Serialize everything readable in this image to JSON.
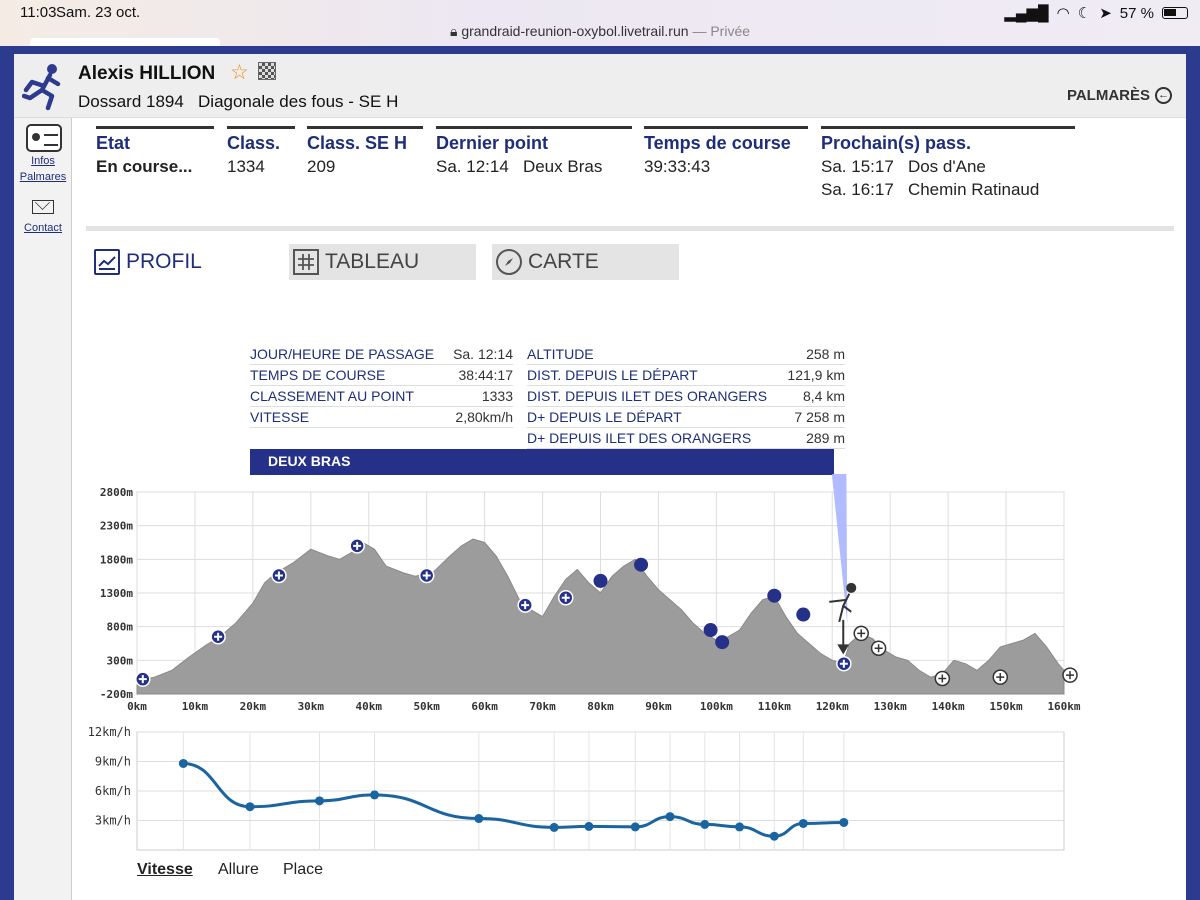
{
  "status_bar": {
    "time": "11:03",
    "date": "Sam. 23 oct.",
    "battery": "57 %",
    "url": "grandraid-reunion-oxybol.livetrail.run",
    "private_label": "— Privée"
  },
  "runner": {
    "name": "Alexis HILLION",
    "bib": "Dossard 1894",
    "race": "Diagonale des fous - SE H"
  },
  "header": {
    "palmares_label": "PALMARÈS"
  },
  "nav": {
    "infos": "Infos",
    "palmares": "Palmares",
    "contact": "Contact"
  },
  "summary": {
    "etat": {
      "label": "Etat",
      "value": "En course..."
    },
    "class": {
      "label": "Class.",
      "value": "1334"
    },
    "class_se": {
      "label": "Class. SE H",
      "value": "209"
    },
    "dernier": {
      "label": "Dernier point",
      "time": "Sa. 12:14",
      "place": "Deux Bras"
    },
    "temps": {
      "label": "Temps de course",
      "value": "39:33:43"
    },
    "prochain": {
      "label": "Prochain(s) pass.",
      "rows": [
        {
          "time": "Sa. 15:17",
          "place": "Dos d'Ane"
        },
        {
          "time": "Sa. 16:17",
          "place": "Chemin Ratinaud"
        }
      ]
    }
  },
  "tabs": {
    "profil": "PROFIL",
    "tableau": "TABLEAU",
    "carte": "CARTE"
  },
  "point_info": {
    "left": [
      {
        "label": "JOUR/HEURE DE PASSAGE",
        "value": "Sa. 12:14"
      },
      {
        "label": "TEMPS DE COURSE",
        "value": "38:44:17"
      },
      {
        "label": "CLASSEMENT AU POINT",
        "value": "1333"
      },
      {
        "label": "VITESSE",
        "value": "2,80km/h"
      }
    ],
    "right": [
      {
        "label": "ALTITUDE",
        "value": "258 m"
      },
      {
        "label": "DIST. DEPUIS LE DÉPART",
        "value": "121,9 km"
      },
      {
        "label": "DIST. DEPUIS ILET DES ORANGERS",
        "value": "8,4 km"
      },
      {
        "label": "D+ DEPUIS LE DÉPART",
        "value": "7 258 m"
      },
      {
        "label": "D+ DEPUIS ILET DES ORANGERS",
        "value": "289 m"
      }
    ],
    "point_name": "DEUX BRAS"
  },
  "chart_data": [
    {
      "type": "area",
      "yticks": [
        "2800m",
        "2300m",
        "1800m",
        "1300m",
        "800m",
        "300m",
        "-200m"
      ],
      "xticks": [
        "0km",
        "10km",
        "20km",
        "30km",
        "40km",
        "50km",
        "60km",
        "70km",
        "80km",
        "90km",
        "100km",
        "110km",
        "120km",
        "130km",
        "140km",
        "150km",
        "160km"
      ],
      "ylim": [
        -200,
        2800
      ],
      "xlim": [
        0,
        160
      ],
      "profile": [
        [
          0,
          0
        ],
        [
          3,
          50
        ],
        [
          6,
          150
        ],
        [
          9,
          350
        ],
        [
          12,
          530
        ],
        [
          14,
          630
        ],
        [
          17,
          850
        ],
        [
          20,
          1150
        ],
        [
          22,
          1450
        ],
        [
          24,
          1600
        ],
        [
          27,
          1750
        ],
        [
          30,
          1950
        ],
        [
          33,
          1850
        ],
        [
          35,
          1800
        ],
        [
          37,
          1900
        ],
        [
          39,
          2050
        ],
        [
          41,
          1950
        ],
        [
          43,
          1700
        ],
        [
          46,
          1600
        ],
        [
          48,
          1550
        ],
        [
          51,
          1600
        ],
        [
          54,
          1850
        ],
        [
          56,
          2000
        ],
        [
          58,
          2100
        ],
        [
          60,
          2050
        ],
        [
          62,
          1850
        ],
        [
          64,
          1550
        ],
        [
          66,
          1200
        ],
        [
          68,
          1050
        ],
        [
          70,
          950
        ],
        [
          72,
          1250
        ],
        [
          74,
          1500
        ],
        [
          76,
          1650
        ],
        [
          78,
          1450
        ],
        [
          80,
          1300
        ],
        [
          82,
          1550
        ],
        [
          84,
          1700
        ],
        [
          86,
          1800
        ],
        [
          88,
          1550
        ],
        [
          90,
          1350
        ],
        [
          92,
          1200
        ],
        [
          94,
          1050
        ],
        [
          96,
          850
        ],
        [
          98,
          700
        ],
        [
          100,
          600
        ],
        [
          102,
          650
        ],
        [
          104,
          750
        ],
        [
          106,
          1000
        ],
        [
          108,
          1200
        ],
        [
          110,
          1250
        ],
        [
          112,
          950
        ],
        [
          114,
          700
        ],
        [
          116,
          550
        ],
        [
          118,
          400
        ],
        [
          120,
          300
        ],
        [
          121.9,
          258
        ],
        [
          123,
          550
        ],
        [
          125,
          700
        ],
        [
          127,
          620
        ],
        [
          129,
          450
        ],
        [
          131,
          350
        ],
        [
          133,
          300
        ],
        [
          135,
          150
        ],
        [
          137,
          50
        ],
        [
          139,
          100
        ],
        [
          141,
          300
        ],
        [
          143,
          250
        ],
        [
          145,
          150
        ],
        [
          147,
          300
        ],
        [
          149,
          500
        ],
        [
          151,
          550
        ],
        [
          153,
          600
        ],
        [
          155,
          700
        ],
        [
          157,
          500
        ],
        [
          159,
          250
        ],
        [
          160,
          150
        ]
      ],
      "checkpoints_passed": [
        [
          1,
          20
        ],
        [
          14,
          650
        ],
        [
          24.5,
          1560
        ],
        [
          38,
          2000
        ],
        [
          50,
          1560
        ],
        [
          67,
          1120
        ],
        [
          74,
          1230
        ],
        [
          122,
          250
        ]
      ],
      "checkpoints_future": [
        [
          125,
          700
        ],
        [
          128,
          480
        ],
        [
          139,
          30
        ],
        [
          149,
          50
        ],
        [
          162,
          80
        ]
      ],
      "timing_points": [
        [
          80,
          1480
        ],
        [
          87,
          1720
        ],
        [
          99,
          750
        ],
        [
          101,
          570
        ],
        [
          110,
          1260
        ],
        [
          115,
          980
        ]
      ],
      "current_km": 121.9
    },
    {
      "type": "line",
      "yticks": [
        "12km/h",
        "9km/h",
        "6km/h",
        "3km/h"
      ],
      "ylim": [
        0,
        12
      ],
      "x": [
        8,
        19.5,
        31.5,
        41,
        59,
        72,
        78,
        86,
        92,
        98,
        104,
        110,
        115,
        122
      ],
      "values": [
        8.8,
        4.4,
        5.0,
        5.6,
        3.2,
        2.3,
        2.4,
        2.35,
        3.4,
        2.6,
        2.35,
        1.4,
        2.7,
        2.8
      ]
    }
  ],
  "subtabs": {
    "vitesse": "Vitesse",
    "allure": "Allure",
    "place": "Place"
  },
  "colors": {
    "accent": "#1f2e7a",
    "profile_fill": "#9c9c9c",
    "speed_line": "#1a64a0"
  }
}
